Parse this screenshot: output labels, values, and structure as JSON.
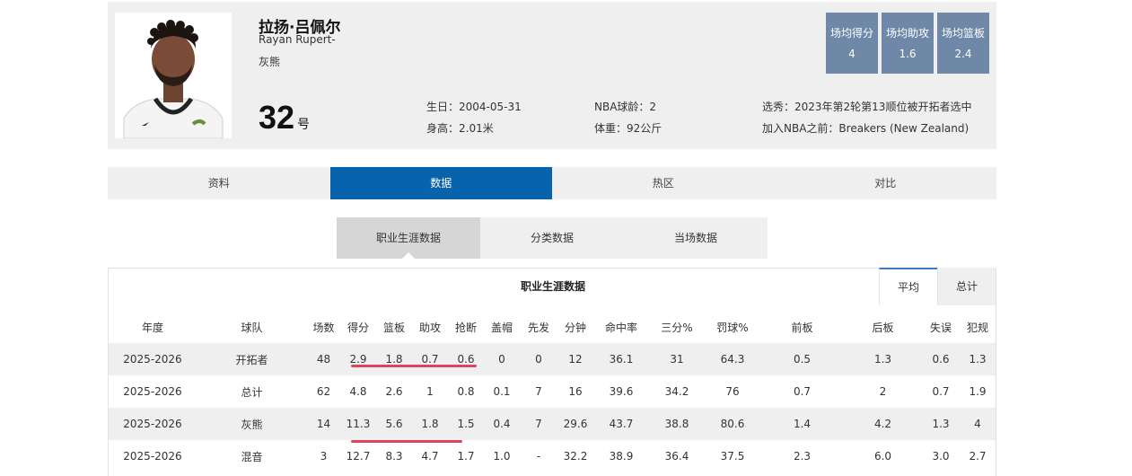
{
  "player": {
    "name_cn": "拉扬·吕佩尔",
    "name_en": "Rayan Rupert-",
    "team": "灰熊",
    "number": "32",
    "number_suffix": "号",
    "birthday": "生日：2004-05-31",
    "height": "身高：2.01米",
    "nba_age": "NBA球龄：2",
    "weight": "体重：92公斤",
    "draft": "选秀：2023年第2轮第13顺位被开拓者选中",
    "pre_nba": "加入NBA之前：Breakers (New Zealand)"
  },
  "summary": [
    {
      "label": "场均得分",
      "value": "4"
    },
    {
      "label": "场均助攻",
      "value": "1.6"
    },
    {
      "label": "场均篮板",
      "value": "2.4"
    }
  ],
  "tabs": [
    "资料",
    "数据",
    "热区",
    "对比"
  ],
  "active_tab": 1,
  "subtabs": [
    "职业生涯数据",
    "分类数据",
    "当场数据"
  ],
  "active_subtab": 0,
  "table": {
    "title": "职业生涯数据",
    "toggle": [
      "平均",
      "总计"
    ],
    "columns": [
      "年度",
      "球队",
      "场数",
      "得分",
      "篮板",
      "助攻",
      "抢断",
      "盖帽",
      "先发",
      "分钟",
      "命中率",
      "三分%",
      "罚球%",
      "前板",
      "后板",
      "失误",
      "犯规"
    ],
    "rows": [
      [
        "2025-2026",
        "开拓者",
        "48",
        "2.9",
        "1.8",
        "0.7",
        "0.6",
        "0",
        "0",
        "12",
        "36.1",
        "31",
        "64.3",
        "0.5",
        "1.3",
        "0.6",
        "1.3"
      ],
      [
        "2025-2026",
        "总计",
        "62",
        "4.8",
        "2.6",
        "1",
        "0.8",
        "0.1",
        "7",
        "16",
        "39.6",
        "34.2",
        "76",
        "0.7",
        "2",
        "0.7",
        "1.9"
      ],
      [
        "2025-2026",
        "灰熊",
        "14",
        "11.3",
        "5.6",
        "1.8",
        "1.5",
        "0.4",
        "7",
        "29.6",
        "43.7",
        "38.8",
        "80.6",
        "1.4",
        "4.2",
        "1.3",
        "4"
      ],
      [
        "2025-2026",
        "混音",
        "3",
        "12.7",
        "8.3",
        "4.7",
        "1.7",
        "1.0",
        "-",
        "32.2",
        "38.9",
        "36.4",
        "37.5",
        "2.3",
        "6.0",
        "3.0",
        "2.7"
      ]
    ]
  },
  "colors": {
    "accent": "#0863ad",
    "stat_box": "#6f88a8",
    "highlight": "#e0435e"
  }
}
